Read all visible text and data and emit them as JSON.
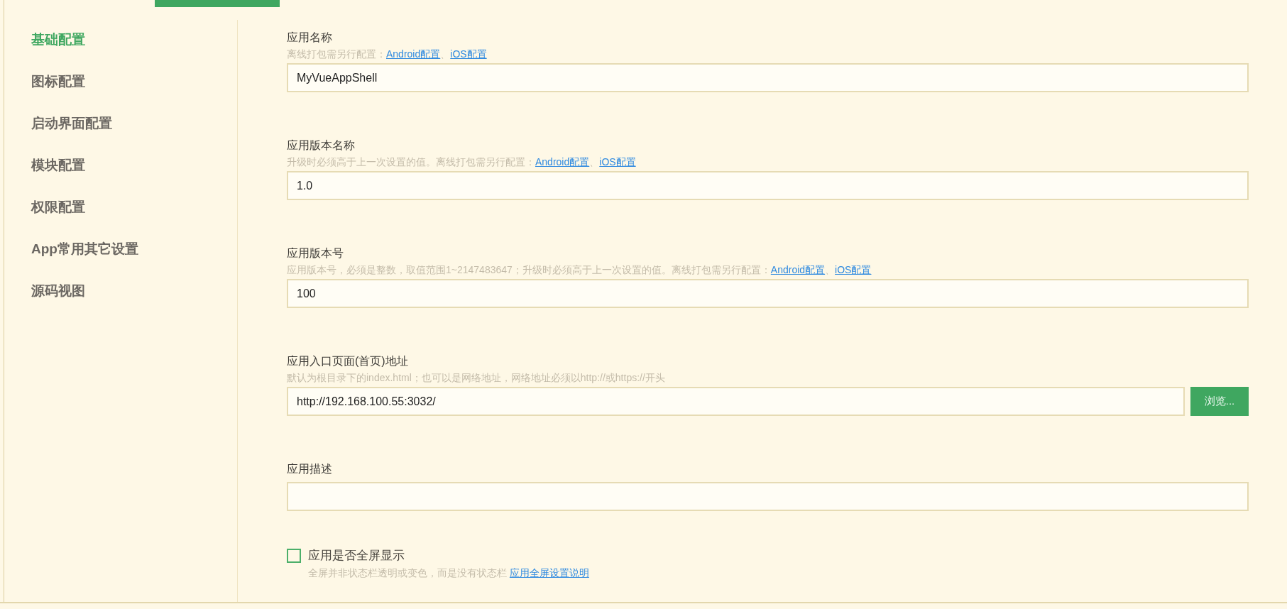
{
  "sidebar": {
    "items": [
      {
        "label": "基础配置",
        "selected": true
      },
      {
        "label": "图标配置",
        "selected": false
      },
      {
        "label": "启动界面配置",
        "selected": false
      },
      {
        "label": "模块配置",
        "selected": false
      },
      {
        "label": "权限配置",
        "selected": false
      },
      {
        "label": "App常用其它设置",
        "selected": false
      },
      {
        "label": "源码视图",
        "selected": false
      }
    ]
  },
  "fields": [
    {
      "label": "应用名称",
      "hint": [
        {
          "kind": "text",
          "text": "离线打包需另行配置："
        },
        {
          "kind": "link",
          "text": "Android配置"
        },
        {
          "kind": "text",
          "text": "、"
        },
        {
          "kind": "link",
          "text": "iOS配置"
        }
      ],
      "value": "MyVueAppShell"
    },
    {
      "label": "应用版本名称",
      "hint": [
        {
          "kind": "text",
          "text": "升级时必须高于上一次设置的值。离线打包需另行配置："
        },
        {
          "kind": "link",
          "text": "Android配置"
        },
        {
          "kind": "text",
          "text": "、"
        },
        {
          "kind": "link",
          "text": "iOS配置"
        }
      ],
      "value": "1.0"
    },
    {
      "label": "应用版本号",
      "hint": [
        {
          "kind": "text",
          "text": "应用版本号，必须是整数，取值范围1~2147483647；升级时必须高于上一次设置的值。离线打包需另行配置："
        },
        {
          "kind": "link",
          "text": "Android配置"
        },
        {
          "kind": "text",
          "text": "、"
        },
        {
          "kind": "link",
          "text": "iOS配置"
        }
      ],
      "value": "100"
    },
    {
      "label": "应用入口页面(首页)地址",
      "hint": [
        {
          "kind": "text",
          "text": "默认为根目录下的index.html；也可以是网络地址，网络地址必须以http://或https://开头"
        }
      ],
      "value": "http://192.168.100.55:3032/",
      "button": "浏览..."
    },
    {
      "label": "应用描述"
    }
  ],
  "fullscreen": {
    "label": "应用是否全屏显示",
    "checked": false,
    "hint": [
      {
        "kind": "text",
        "text": "全屏并非状态栏透明或变色，而是没有状态栏 "
      },
      {
        "kind": "link",
        "text": "应用全屏设置说明"
      }
    ]
  }
}
